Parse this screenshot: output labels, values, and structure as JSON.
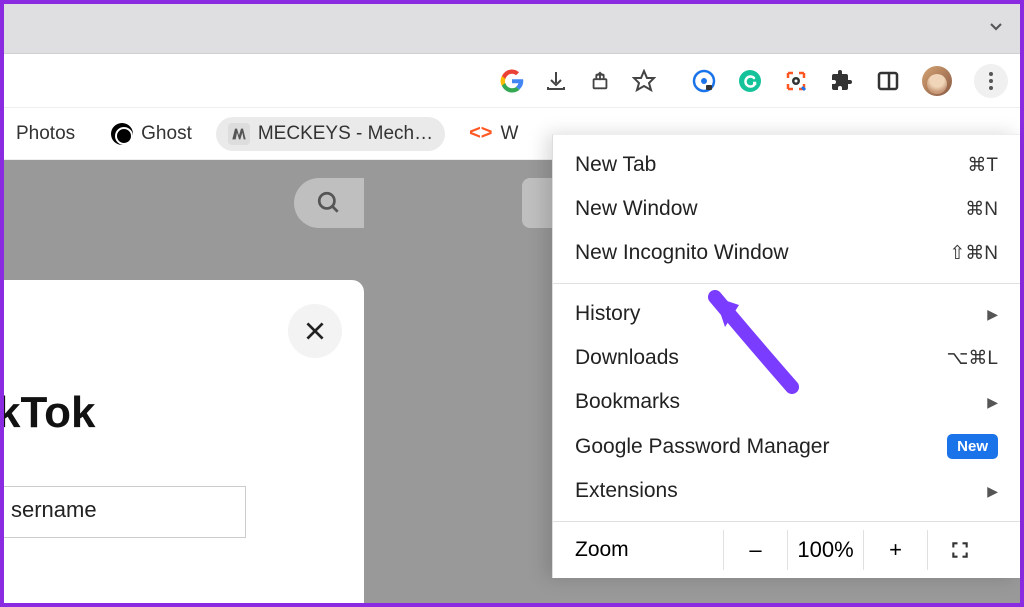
{
  "bookmarks": [
    {
      "label": "Photos",
      "icon": "photos"
    },
    {
      "label": "Ghost",
      "icon": "ghost"
    },
    {
      "label": "MECKEYS - Mech…",
      "icon": "meckeys"
    },
    {
      "label": "W",
      "icon": "code"
    }
  ],
  "menu": {
    "new_tab": {
      "label": "New Tab",
      "shortcut": "⌘T"
    },
    "new_window": {
      "label": "New Window",
      "shortcut": "⌘N"
    },
    "new_incognito": {
      "label": "New Incognito Window",
      "shortcut": "⇧⌘N"
    },
    "history": {
      "label": "History"
    },
    "downloads": {
      "label": "Downloads",
      "shortcut": "⌥⌘L"
    },
    "bookmarks": {
      "label": "Bookmarks"
    },
    "gpm": {
      "label": "Google Password Manager",
      "badge": "New"
    },
    "extensions": {
      "label": "Extensions"
    },
    "zoom": {
      "label": "Zoom",
      "level": "100%",
      "minus": "–",
      "plus": "+"
    }
  },
  "page": {
    "tiktok_title": "kTok",
    "username_label": "sername"
  },
  "icons": {
    "google": "G",
    "download": "download",
    "share": "share",
    "star": "star",
    "tracker": "tracker",
    "grammarly": "grammarly",
    "screenshot": "screenshot",
    "puzzle": "puzzle",
    "panel": "panel",
    "search": "search",
    "close": "close"
  }
}
